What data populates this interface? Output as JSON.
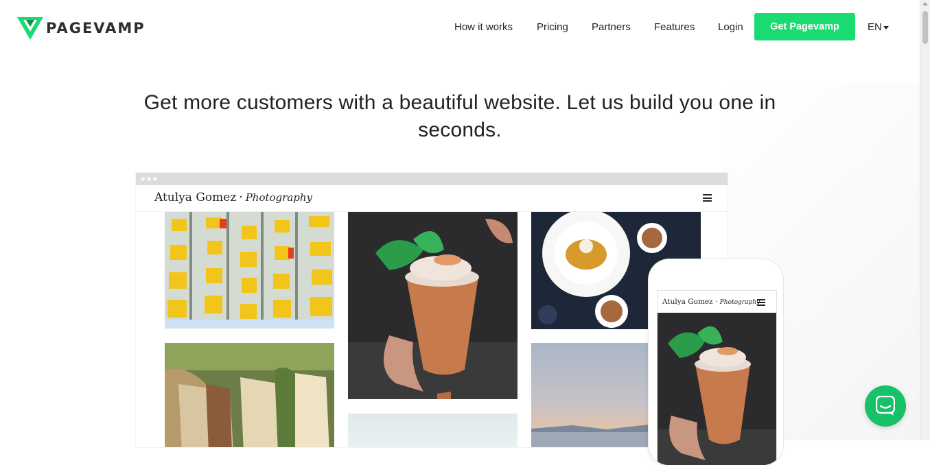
{
  "header": {
    "logo_text": "PAGEVAMP",
    "nav": [
      {
        "label": "How it works"
      },
      {
        "label": "Pricing"
      },
      {
        "label": "Partners"
      },
      {
        "label": "Features"
      },
      {
        "label": "Login"
      }
    ],
    "cta_label": "Get Pagevamp",
    "language": "EN"
  },
  "hero": {
    "headline": "Get more customers with a beautiful website. Let us build you one in seconds."
  },
  "mockup": {
    "site_name": "Atulya Gomez",
    "separator": "·",
    "site_tagline": "Photography"
  },
  "colors": {
    "brand_green": "#19db72",
    "logo_dark": "#2a2f33"
  },
  "icons": {
    "menu": "hamburger-icon",
    "chat": "chat-icon",
    "caret": "caret-down-icon"
  }
}
